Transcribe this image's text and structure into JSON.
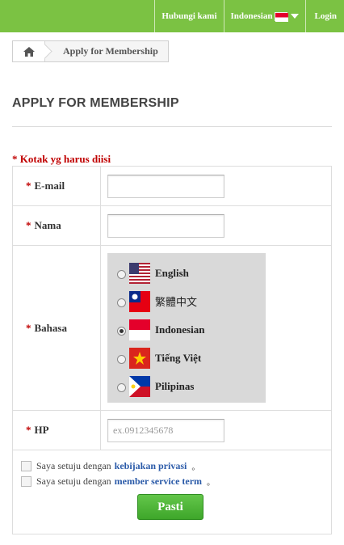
{
  "topbar": {
    "contact_label": "Hubungi kami",
    "language_label": "Indonesian",
    "login_label": "Login",
    "bg_color": "#7bc243"
  },
  "breadcrumb": {
    "home_icon": "home-icon",
    "current": "Apply for Membership"
  },
  "page": {
    "title": "APPLY FOR MEMBERSHIP",
    "required_note": "* Kotak yg harus diisi"
  },
  "form": {
    "email_label": "E-mail",
    "email_value": "",
    "name_label": "Nama",
    "name_value": "",
    "language_label": "Bahasa",
    "languages": [
      {
        "name": "English",
        "flag": "us-flag",
        "selected": false
      },
      {
        "name": "繁體中文",
        "flag": "taiwan-flag",
        "selected": false
      },
      {
        "name": "Indonesian",
        "flag": "indonesia-flag",
        "selected": true
      },
      {
        "name": "Tiếng Việt",
        "flag": "vietnam-flag",
        "selected": false
      },
      {
        "name": "Pilipinas",
        "flag": "philippines-flag",
        "selected": false
      }
    ],
    "phone_label": "HP",
    "phone_placeholder": "ex.0912345678",
    "required_mark": "*"
  },
  "agreements": {
    "prefix": "Saya setuju dengan",
    "privacy_link": "kebijakan privasi",
    "terms_link": "member service term",
    "suffix": "。"
  },
  "submit_label": "Pasti"
}
